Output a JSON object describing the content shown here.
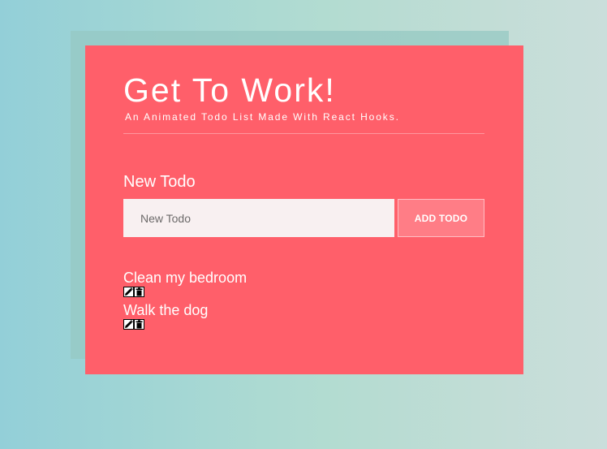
{
  "app": {
    "title": "Get To Work!",
    "subtitle": "An Animated Todo List Made With React Hooks."
  },
  "form": {
    "label": "New Todo",
    "input_value": "",
    "input_placeholder": "New Todo",
    "add_button_label": "ADD TODO"
  },
  "todos": [
    {
      "text": "Clean my bedroom",
      "edit_icon": "pencil-icon",
      "delete_icon": "trash-icon"
    },
    {
      "text": "Walk the dog",
      "edit_icon": "pencil-icon",
      "delete_icon": "trash-icon"
    }
  ],
  "colors": {
    "card": "#ff5f6a",
    "button": "#ff7d86",
    "input": "#f8f0f1",
    "background_start": "#93cfd8",
    "background_end": "#cadedb"
  }
}
